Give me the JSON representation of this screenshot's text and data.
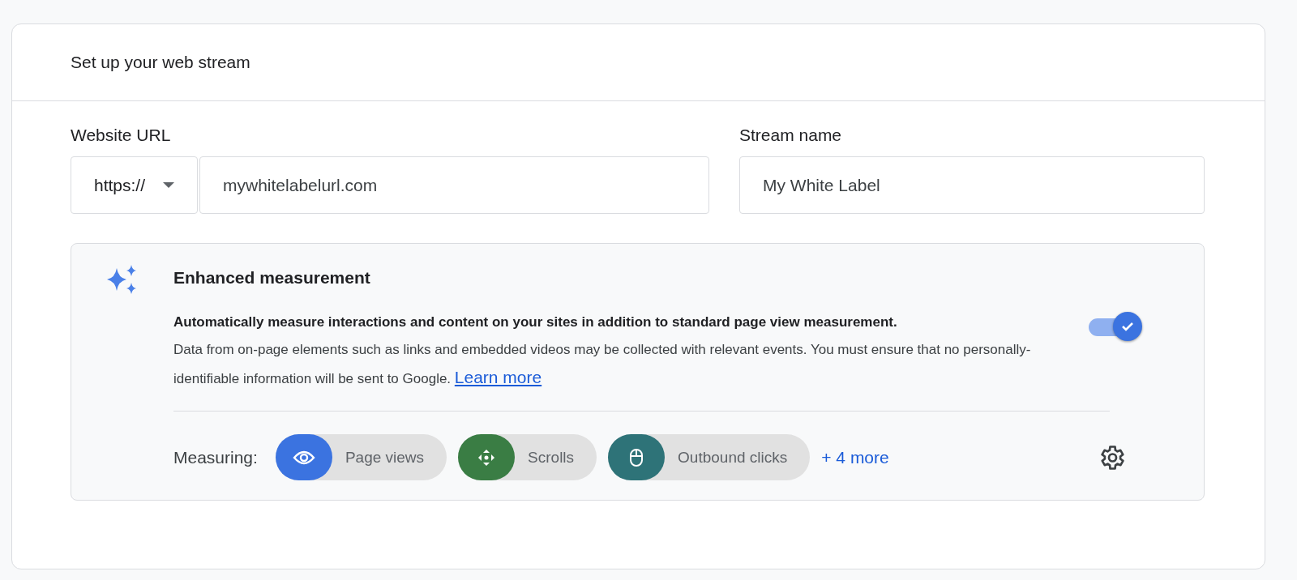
{
  "card": {
    "title": "Set up your web stream"
  },
  "website_url": {
    "label": "Website URL",
    "protocol": "https://",
    "value": "mywhitelabelurl.com"
  },
  "stream_name": {
    "label": "Stream name",
    "value": "My White Label"
  },
  "enhanced_measurement": {
    "title": "Enhanced measurement",
    "on": true,
    "lead": "Automatically measure interactions and content on your sites in addition to standard page view measurement.",
    "body": "Data from on-page elements such as links and embedded videos may be collected with relevant events. You must ensure that no personally-identifiable information will be sent to Google.",
    "link": "Learn more",
    "measuring_label": "Measuring:",
    "chips": [
      {
        "kind": "eye",
        "label": "Page views",
        "color": "#3b73e0"
      },
      {
        "kind": "scroll",
        "label": "Scrolls",
        "color": "#3a7d44"
      },
      {
        "kind": "mouse",
        "label": "Outbound clicks",
        "color": "#2e7378"
      }
    ],
    "more": "+ 4 more"
  }
}
